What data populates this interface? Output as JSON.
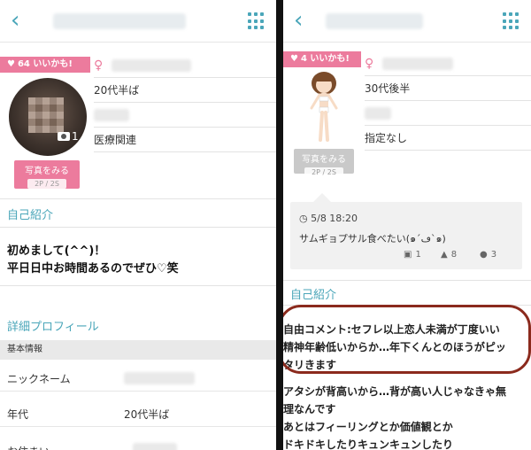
{
  "left": {
    "likes_badge": "64 いいかも!",
    "info": [
      "20代半ば",
      "医療関連"
    ],
    "photo_button": {
      "label": "写真をみる",
      "count": "2P / 2S"
    },
    "camera_count": "1",
    "self_intro_title": "自己紹介",
    "self_intro_lines": [
      "初めまして(^^)！",
      "平日日中お時間あるのでぜひ♡笑"
    ],
    "detail_title": "詳細プロフィール",
    "basic_info_label": "基本情報",
    "details": [
      {
        "key": "ニックネーム",
        "value": ""
      },
      {
        "key": "年代",
        "value": "20代半ば"
      },
      {
        "key": "お住まい",
        "value": ""
      }
    ]
  },
  "right": {
    "likes_badge": "4 いいかも!",
    "info": [
      "30代後半",
      "指定なし"
    ],
    "photo_button": {
      "label": "写真をみる",
      "count": "2P / 2S"
    },
    "status": {
      "time": "5/8 18:20",
      "text": "サムギョプサル食べたい(๑´ڡ`๑)",
      "photos": "1",
      "likes": "8",
      "comments": "3"
    },
    "self_intro_title": "自己紹介",
    "comment_lines": [
      "自由コメント:セフレ以上恋人未満が丁度いい",
      "精神年齢低いからか…年下くんとのほうがピッ",
      "タリきます"
    ],
    "more_lines": [
      "アタシが背高いから…背が高い人じゃなきゃ無",
      "理なんです",
      "あとはフィーリングとか価値観とか",
      "ドキドキしたりキュンキュンしたり"
    ]
  },
  "colors": {
    "accent": "#4aa6b9",
    "pink": "#ec7b9d",
    "highlight": "#8b2a1d"
  },
  "icons": [
    "back-chevron",
    "grid-menu",
    "heart",
    "female",
    "camera",
    "clock",
    "thumbs-up",
    "speech-bubble"
  ]
}
